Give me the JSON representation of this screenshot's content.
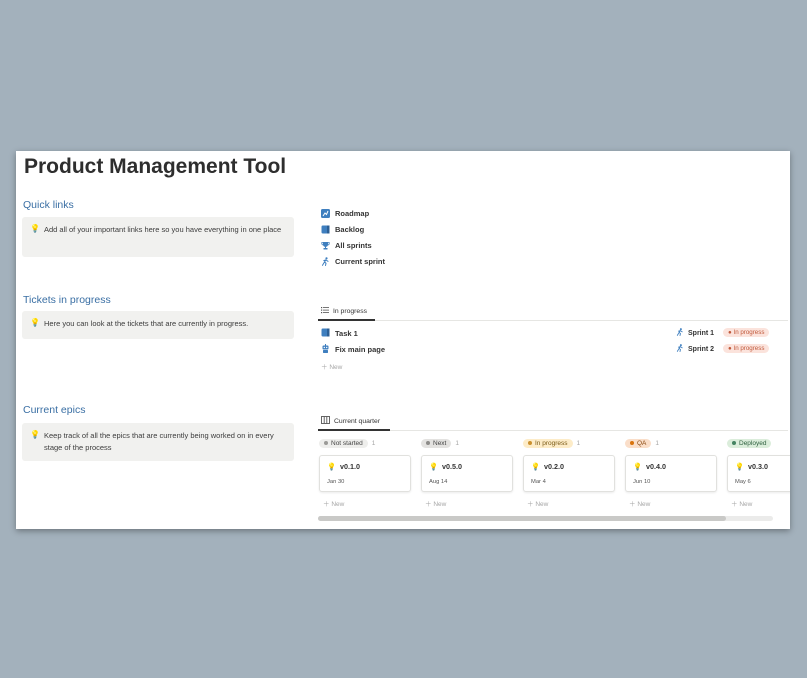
{
  "page": {
    "title": "Product Management Tool"
  },
  "quick_links": {
    "heading": "Quick links",
    "callout": "Add all of your important links here so you have everything in one place"
  },
  "tickets": {
    "heading": "Tickets in progress",
    "callout": "Here you can look at the tickets that are currently in progress."
  },
  "epics": {
    "heading": "Current epics",
    "callout": "Keep track of all the epics that are currently being worked on in every stage of the process"
  },
  "links": [
    {
      "label": "Roadmap",
      "icon": "roadmap-icon",
      "color": "#3f7fbf"
    },
    {
      "label": "Backlog",
      "icon": "book-icon",
      "color": "#3f7fbf"
    },
    {
      "label": "All sprints",
      "icon": "trophy-icon",
      "color": "#3f7fbf"
    },
    {
      "label": "Current sprint",
      "icon": "runner-icon",
      "color": "#3f7fbf"
    }
  ],
  "tickets_view": {
    "tab": "In progress",
    "rows": [
      {
        "name": "Task 1",
        "sprint": "Sprint 1",
        "status": "In progress"
      },
      {
        "name": "Fix main page",
        "sprint": "Sprint 2",
        "status": "In progress"
      }
    ],
    "new_label": "New"
  },
  "epics_view": {
    "tab": "Current quarter",
    "columns": [
      {
        "status": "Not started",
        "count": "1",
        "bg": "#eeeeec",
        "dot": "#9b9a97",
        "fg": "#444444",
        "card": {
          "title": "v0.1.0",
          "date": "Jan 30"
        }
      },
      {
        "status": "Next",
        "count": "1",
        "bg": "#e3e2e0",
        "dot": "#8c8b88",
        "fg": "#444444",
        "card": {
          "title": "v0.5.0",
          "date": "Aug 14"
        }
      },
      {
        "status": "In progress",
        "count": "1",
        "bg": "#fdecc8",
        "dot": "#cb912f",
        "fg": "#7a5a16",
        "card": {
          "title": "v0.2.0",
          "date": "Mar 4"
        }
      },
      {
        "status": "QA",
        "count": "1",
        "bg": "#fadec9",
        "dot": "#d9730d",
        "fg": "#8a4a12",
        "card": {
          "title": "v0.4.0",
          "date": "Jun 10"
        }
      },
      {
        "status": "Deployed",
        "count": "",
        "bg": "#dbeddb",
        "dot": "#448361",
        "fg": "#2d5f3e",
        "card": {
          "title": "v0.3.0",
          "date": "May 6"
        }
      }
    ],
    "new_label": "New"
  }
}
